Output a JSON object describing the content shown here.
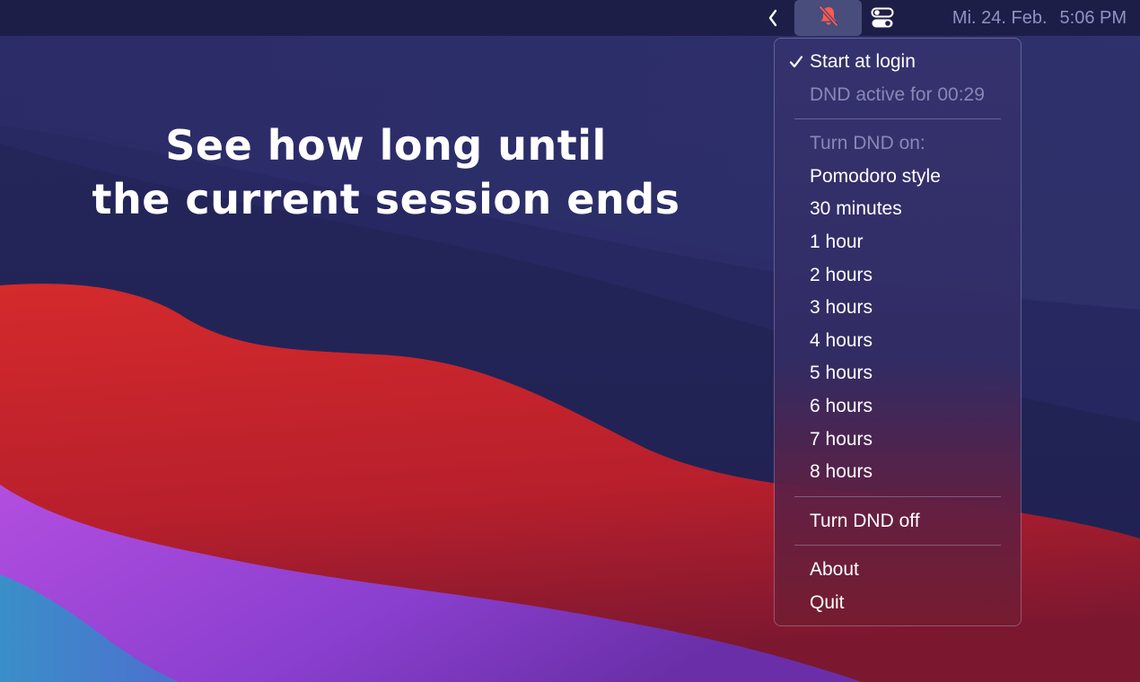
{
  "menubar": {
    "date": "Mi. 24. Feb.",
    "time": "5:06 PM",
    "icons": {
      "chevron": "chevron-left-icon",
      "dnd": "bell-slash-icon",
      "control": "control-center-icon"
    },
    "dnd_icon_color": "#ff5a4f"
  },
  "headline": {
    "line1": "See how long until",
    "line2": "the current session ends"
  },
  "menu": {
    "start_at_login": "Start at login",
    "start_at_login_checked": true,
    "dnd_status": "DND active for 00:29",
    "turn_on_header": "Turn DND on:",
    "durations": [
      "Pomodoro style",
      "30 minutes",
      "1 hour",
      "2 hours",
      "3 hours",
      "4 hours",
      "5 hours",
      "6 hours",
      "7 hours",
      "8 hours"
    ],
    "turn_off": "Turn DND off",
    "about": "About",
    "quit": "Quit"
  }
}
